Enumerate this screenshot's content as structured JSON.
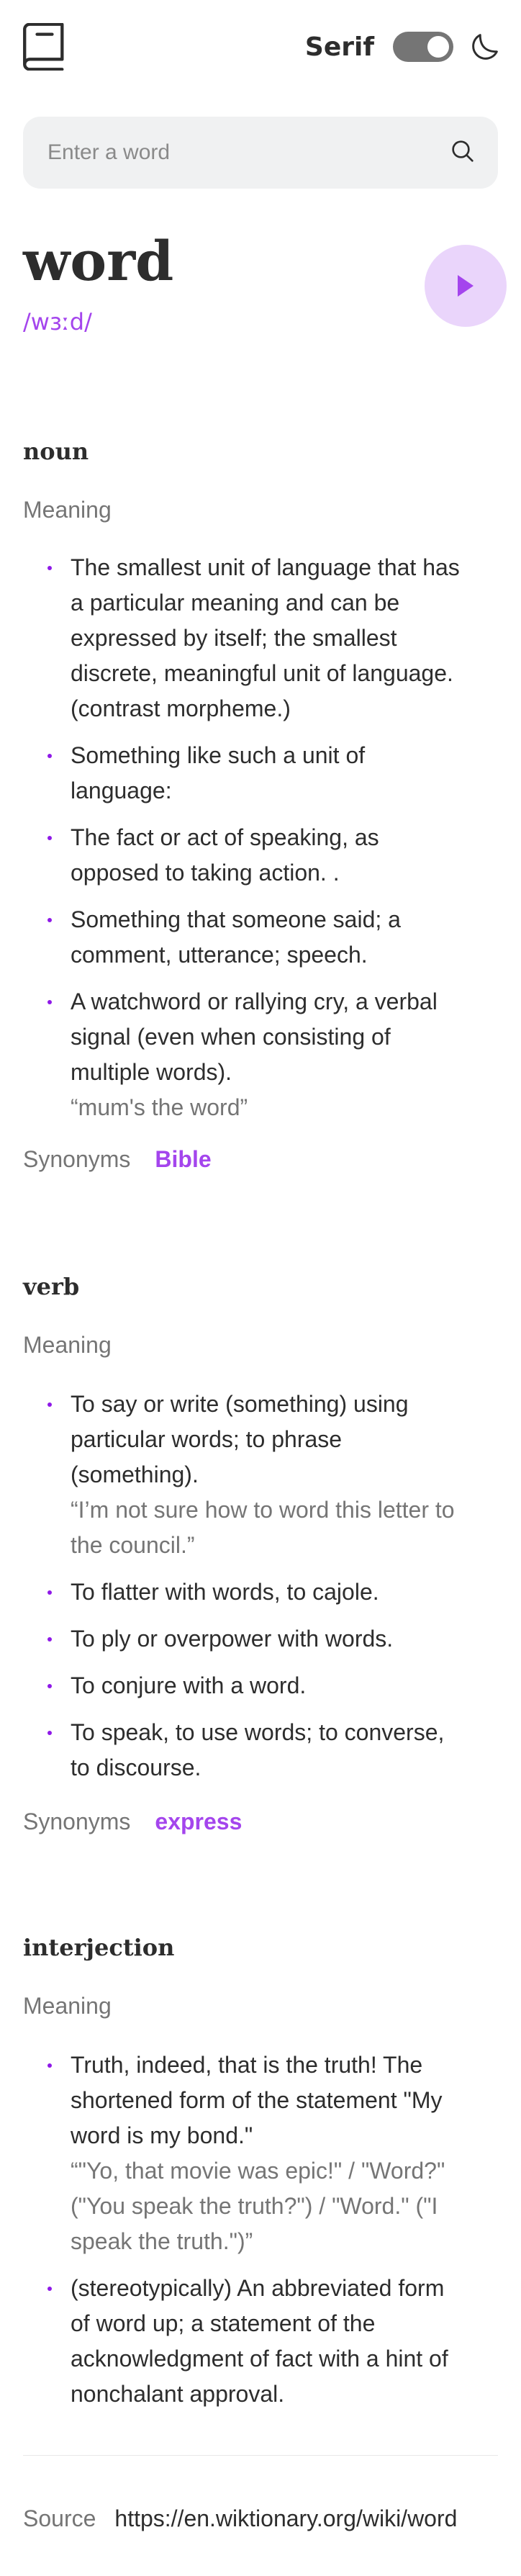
{
  "header": {
    "font_label": "Serif",
    "icons": [
      "book-icon",
      "moon-icon",
      "search-icon",
      "play-icon"
    ]
  },
  "search": {
    "placeholder": "Enter a word",
    "value": ""
  },
  "word": {
    "text": "word",
    "phonetic": "/wɜːd/"
  },
  "sections": [
    {
      "pos": "noun",
      "meaning_label": "Meaning",
      "definitions": [
        {
          "text": "The smallest unit of language that has a particular meaning and can be expressed by itself; the smallest discrete, meaningful unit of language. (contrast morpheme.)",
          "example": ""
        },
        {
          "text": "Something like such a unit of language:",
          "example": ""
        },
        {
          "text": "The fact or act of speaking, as opposed to taking action. .",
          "example": ""
        },
        {
          "text": "Something that someone said; a comment, utterance; speech.",
          "example": ""
        },
        {
          "text": "A watchword or rallying cry, a verbal signal (even when consisting of multiple words).",
          "example": "“mum's the word”"
        }
      ],
      "synonyms_label": "Synonyms",
      "synonyms": "Bible"
    },
    {
      "pos": "verb",
      "meaning_label": "Meaning",
      "definitions": [
        {
          "text": "To say or write (something) using particular words; to phrase (something).",
          "example": "“I’m not sure how to word this letter to the council.”"
        },
        {
          "text": "To flatter with words, to cajole.",
          "example": ""
        },
        {
          "text": "To ply or overpower with words.",
          "example": ""
        },
        {
          "text": "To conjure with a word.",
          "example": ""
        },
        {
          "text": "To speak, to use words; to converse, to discourse.",
          "example": ""
        }
      ],
      "synonyms_label": "Synonyms",
      "synonyms": "express"
    },
    {
      "pos": "interjection",
      "meaning_label": "Meaning",
      "definitions": [
        {
          "text": "Truth, indeed, that is the truth! The shortened form of the statement \"My word is my bond.\"",
          "example": "“\"Yo, that movie was epic!\" / \"Word?\" (\"You speak the truth?\") / \"Word.\" (\"I speak the truth.\")”"
        },
        {
          "text": "(stereotypically) An abbreviated form of word up; a statement of the acknowledgment of fact with a hint of nonchalant approval.",
          "example": ""
        }
      ]
    }
  ],
  "source": {
    "label": "Source",
    "url": "https://en.wiktionary.org/wiki/word"
  },
  "colors": {
    "accent": "#a445ed",
    "play_bg": "#ead5fb",
    "toggle": "#757575",
    "muted": "#757575",
    "search_bg": "#f0f1f2"
  }
}
